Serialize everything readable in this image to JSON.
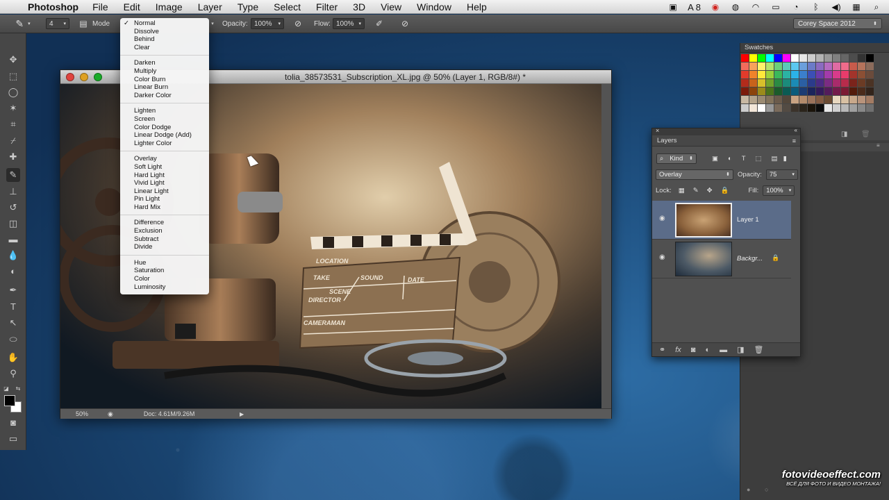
{
  "menubar": {
    "app_name": "Photoshop",
    "menus": [
      "File",
      "Edit",
      "Image",
      "Layer",
      "Type",
      "Select",
      "Filter",
      "3D",
      "View",
      "Window",
      "Help"
    ],
    "status_text": "8"
  },
  "options_bar": {
    "brush_size": "4",
    "mode_label": "Mode",
    "opacity_label": "Opacity:",
    "opacity_value": "100%",
    "flow_label": "Flow:",
    "flow_value": "100%",
    "workspace": "Corey Space 2012"
  },
  "blend_menu": {
    "selected": "Normal",
    "groups": [
      [
        "Normal",
        "Dissolve",
        "Behind",
        "Clear"
      ],
      [
        "Darken",
        "Multiply",
        "Color Burn",
        "Linear Burn",
        "Darker Color"
      ],
      [
        "Lighten",
        "Screen",
        "Color Dodge",
        "Linear Dodge (Add)",
        "Lighter Color"
      ],
      [
        "Overlay",
        "Soft Light",
        "Hard Light",
        "Vivid Light",
        "Linear Light",
        "Pin Light",
        "Hard Mix"
      ],
      [
        "Difference",
        "Exclusion",
        "Subtract",
        "Divide"
      ],
      [
        "Hue",
        "Saturation",
        "Color",
        "Luminosity"
      ]
    ]
  },
  "document": {
    "title": "tolia_38573531_Subscription_XL.jpg @ 50% (Layer 1, RGB/8#) *",
    "zoom": "50%",
    "doc_size": "Doc: 4.61M/9.26M",
    "canvas_text": {
      "location": "LOCATION",
      "take": "TAKE",
      "scene": "SCENE",
      "sound": "SOUND",
      "date": "DATE",
      "director": "DIRECTOR",
      "cameraman": "CAMERAMAN"
    }
  },
  "swatches": {
    "title": "Swatches",
    "colors": [
      "#ff0000",
      "#ffff00",
      "#00ff00",
      "#00ffff",
      "#0000ff",
      "#ff00ff",
      "#ffffff",
      "#e6e6e6",
      "#cccccc",
      "#b3b3b3",
      "#999999",
      "#808080",
      "#666666",
      "#4d4d4d",
      "#333333",
      "#000000",
      "#f26b5b",
      "#f7a35b",
      "#fff26b",
      "#b5e36b",
      "#6bd07b",
      "#5bcab8",
      "#5bc8f0",
      "#6b9fdc",
      "#6b7bc8",
      "#8b6bc0",
      "#b56bc0",
      "#e06ba3",
      "#f06b8b",
      "#c85b4b",
      "#b5735b",
      "#8b6b5b",
      "#e23b2b",
      "#f0832b",
      "#ffe83b",
      "#9cd13b",
      "#3bb85b",
      "#2bb3a3",
      "#2bb3e8",
      "#3b7fcc",
      "#3b4fb5",
      "#6b3bab",
      "#a33bab",
      "#d83b8b",
      "#e83b6b",
      "#a3342b",
      "#8b4f34",
      "#6b4b3b",
      "#b32b1b",
      "#c8631b",
      "#d8c02b",
      "#73a32b",
      "#2b8b43",
      "#1b8b7b",
      "#1b8bb5",
      "#2b5fa3",
      "#2b3b8b",
      "#4b2b83",
      "#7b2b83",
      "#a82b6b",
      "#b82b4b",
      "#7b241b",
      "#6b3b24",
      "#4b3324",
      "#7b1b0b",
      "#8b430b",
      "#9b8b1b",
      "#4b731b",
      "#1b5b2b",
      "#0b5b53",
      "#0b5b7b",
      "#1b3b73",
      "#1b245b",
      "#331b5b",
      "#531b5b",
      "#731b4b",
      "#7b1b33",
      "#531b0b",
      "#4b2b1b",
      "#33241b",
      "#c8b8a3",
      "#b3a38b",
      "#9b8b73",
      "#83735b",
      "#6b5b4b",
      "#53473b",
      "#c8a383",
      "#b38b6b",
      "#9b735b",
      "#835b43",
      "#6b4b33",
      "#e8d8c0",
      "#d8c0a3",
      "#c8a88b",
      "#b8937b",
      "#a37b63",
      "#cccccc",
      "#f2e6d8",
      "#ffffff",
      "#999999",
      "#7b6b5b",
      "#534b43",
      "#3b332b",
      "#2b241b",
      "#1b140b",
      "#0b0b0b",
      "#e8e8e8",
      "#d0d0d0",
      "#b8b8b8",
      "#a0a0a0",
      "#888888",
      "#707070"
    ]
  },
  "layers": {
    "title": "Layers",
    "filter_kind": "Kind",
    "blend_mode": "Overlay",
    "opacity_label": "Opacity:",
    "opacity_value": "75",
    "lock_label": "Lock:",
    "fill_label": "Fill:",
    "fill_value": "100%",
    "items": [
      {
        "name": "Layer 1",
        "selected": true
      },
      {
        "name": "Backgr...",
        "selected": false
      }
    ]
  },
  "watermark": {
    "site": "fotovideoeffect.com",
    "tagline": "ВСЁ ДЛЯ ФОТО И ВИДЕО МОНТАЖА!"
  }
}
